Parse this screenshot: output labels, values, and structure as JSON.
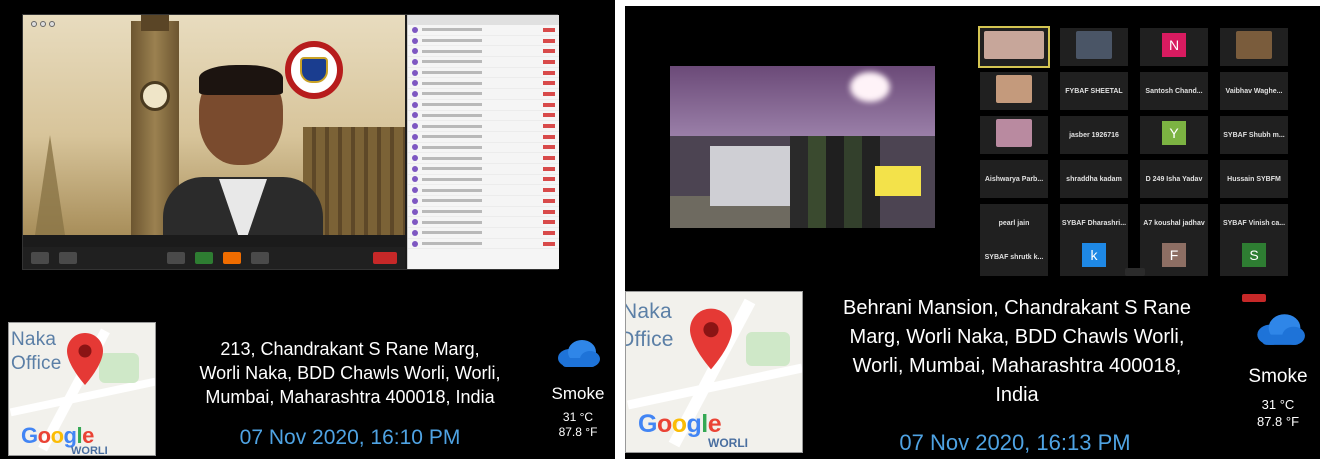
{
  "left": {
    "map": {
      "label_line1": "Naka",
      "label_line2": "Office",
      "brand": "Google",
      "area": "WORLI"
    },
    "address": {
      "line1": "213, Chandrakant S Rane Marg,",
      "line2": "Worli Naka, BDD Chawls Worli, Worli,",
      "line3": "Mumbai, Maharashtra 400018, India"
    },
    "datetime": "07 Nov 2020, 16:10 PM",
    "weather": {
      "condition": "Smoke",
      "temp_c": "31 °C",
      "temp_f": "87.8 °F",
      "icon": "cloud-icon"
    }
  },
  "right": {
    "map": {
      "label_line1": "Naka",
      "label_line2": "Office",
      "brand": "Google",
      "area": "WORLI"
    },
    "address": {
      "line1": "Behrani Mansion, Chandrakant S Rane",
      "line2": "Marg, Worli Naka, BDD Chawls Worli,",
      "line3": "Worli, Mumbai, Maharashtra 400018,",
      "line4": "India"
    },
    "datetime": "07 Nov 2020, 16:13 PM",
    "weather": {
      "condition": "Smoke",
      "temp_c": "31 °C",
      "temp_f": "87.8 °F",
      "icon": "cloud-icon"
    },
    "tiles": {
      "letter_n": "N",
      "letter_y": "Y",
      "letter_k": "k",
      "letter_f": "F",
      "letter_s": "S",
      "name_r2c1": "FYBAF SHEETAL",
      "name_r2c2": "Santosh Chand...",
      "name_r2c3": "Vaibhav Waghe...",
      "name_r3c2": "jasber 1926716",
      "name_r3c4": "SYBAF Shubh m...",
      "name_r4c1": "Aishwarya Parb...",
      "name_r4c2": "shraddha kadam",
      "name_r4c3": "D 249 Isha Yadav",
      "name_r4c4": "Hussain SYBFM",
      "name_r5c1": "pearl jain",
      "name_r5c2": "SYBAF Dharashri...",
      "name_r5c3": "A7 koushal jadhav",
      "name_r5c4": "SYBAF Vinish ca...",
      "name_r6c1": "SYBAF shrutk k...",
      "colors": {
        "n": "#d81b60",
        "y": "#7cb342",
        "k": "#1e88e5",
        "f": "#8d6e63",
        "s": "#2e7d32"
      }
    }
  }
}
